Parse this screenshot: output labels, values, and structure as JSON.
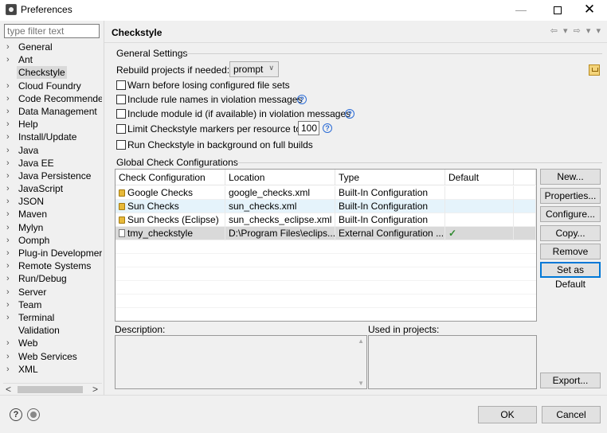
{
  "window": {
    "title": "Preferences"
  },
  "filter": {
    "placeholder": "type filter text"
  },
  "tree": [
    {
      "label": "General",
      "arrow": true
    },
    {
      "label": "Ant",
      "arrow": true
    },
    {
      "label": "Checkstyle",
      "arrow": false,
      "selected": true
    },
    {
      "label": "Cloud Foundry",
      "arrow": true
    },
    {
      "label": "Code Recommende",
      "arrow": true
    },
    {
      "label": "Data Management",
      "arrow": true
    },
    {
      "label": "Help",
      "arrow": true
    },
    {
      "label": "Install/Update",
      "arrow": true
    },
    {
      "label": "Java",
      "arrow": true
    },
    {
      "label": "Java EE",
      "arrow": true
    },
    {
      "label": "Java Persistence",
      "arrow": true
    },
    {
      "label": "JavaScript",
      "arrow": true
    },
    {
      "label": "JSON",
      "arrow": true
    },
    {
      "label": "Maven",
      "arrow": true
    },
    {
      "label": "Mylyn",
      "arrow": true
    },
    {
      "label": "Oomph",
      "arrow": true
    },
    {
      "label": "Plug-in Developmer",
      "arrow": true
    },
    {
      "label": "Remote Systems",
      "arrow": true
    },
    {
      "label": "Run/Debug",
      "arrow": true
    },
    {
      "label": "Server",
      "arrow": true
    },
    {
      "label": "Team",
      "arrow": true
    },
    {
      "label": "Terminal",
      "arrow": true
    },
    {
      "label": "Validation",
      "arrow": false
    },
    {
      "label": "Web",
      "arrow": true
    },
    {
      "label": "Web Services",
      "arrow": true
    },
    {
      "label": "XML",
      "arrow": true
    }
  ],
  "page": {
    "title": "Checkstyle"
  },
  "general": {
    "title": "General Settings",
    "rebuild_label": "Rebuild projects if needed:",
    "rebuild_value": "prompt",
    "warn_label": "Warn before losing configured file sets",
    "rule_names_label": "Include rule names in violation messages",
    "module_id_label": "Include module id (if available) in violation messages",
    "limit_label": "Limit Checkstyle markers per resource to",
    "limit_value": "100",
    "background_label": "Run Checkstyle in background on full builds"
  },
  "global": {
    "title": "Global Check Configurations",
    "columns": [
      "Check Configuration",
      "Location",
      "Type",
      "Default"
    ],
    "rows": [
      {
        "name": "Google Checks",
        "location": "google_checks.xml",
        "type": "Built-In Configuration",
        "default": "",
        "icon": "lock-icon"
      },
      {
        "name": "Sun Checks",
        "location": "sun_checks.xml",
        "type": "Built-In Configuration",
        "default": "",
        "icon": "lock-icon"
      },
      {
        "name": "Sun Checks (Eclipse)",
        "location": "sun_checks_eclipse.xml",
        "type": "Built-In Configuration",
        "default": "",
        "icon": "lock-icon"
      },
      {
        "name": "tmy_checkstyle",
        "location": "D:\\Program Files\\eclips...",
        "type": "External Configuration ...",
        "default": "✓",
        "icon": "file-icon"
      }
    ]
  },
  "buttons": {
    "new": "New...",
    "properties": "Properties...",
    "configure": "Configure...",
    "copy": "Copy...",
    "remove": "Remove",
    "set_default": "Set as Default",
    "export": "Export..."
  },
  "description": {
    "label": "Description:"
  },
  "used": {
    "label": "Used in projects:"
  },
  "dialog": {
    "ok": "OK",
    "cancel": "Cancel"
  }
}
